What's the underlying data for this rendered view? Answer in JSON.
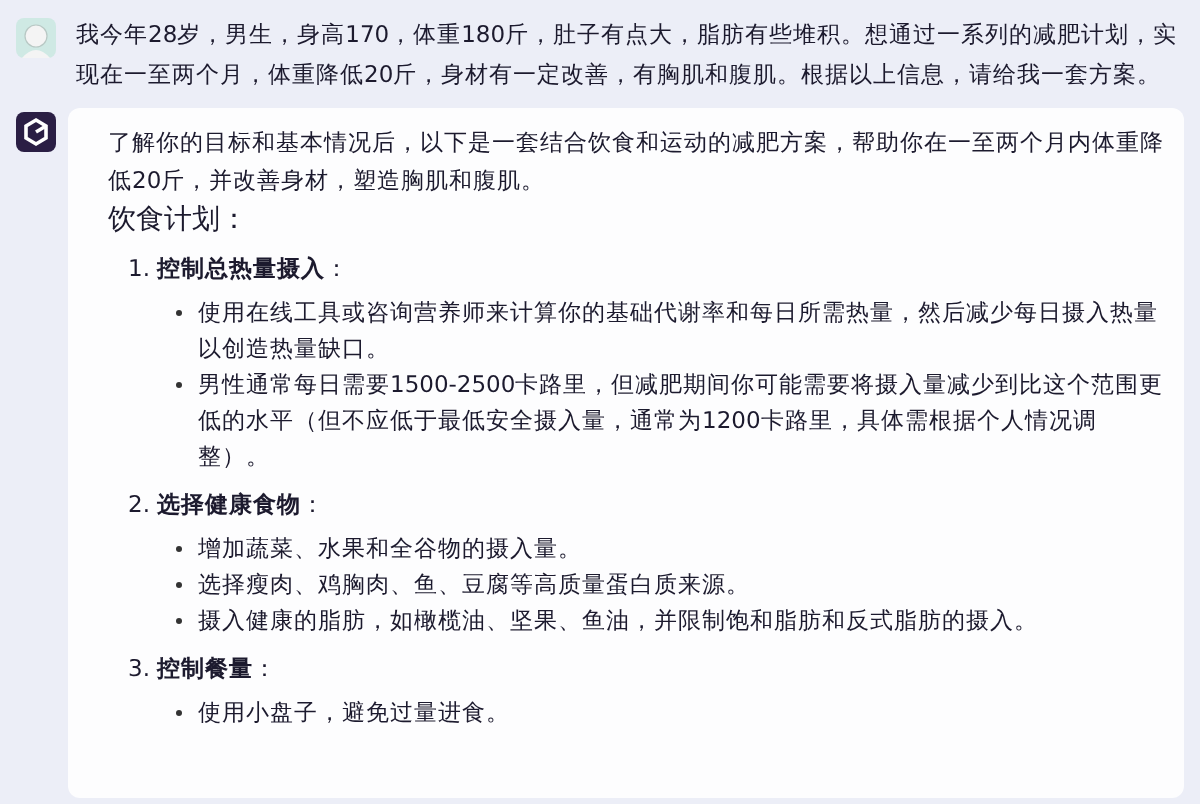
{
  "user_message": {
    "text": "我今年28岁，男生，身高170，体重180斤，肚子有点大，脂肪有些堆积。想通过一系列的减肥计划，实现在一至两个月，体重降低20斤，身材有一定改善，有胸肌和腹肌。根据以上信息，请给我一套方案。"
  },
  "reply": {
    "intro": "了解你的目标和基本情况后，以下是一套结合饮食和运动的减肥方案，帮助你在一至两个月内体重降低20斤，并改善身材，塑造胸肌和腹肌。",
    "heading": "饮食计划：",
    "sections": [
      {
        "title": "1. **控制总热量摄入**：",
        "bullets": [
          "使用在线工具或咨询营养师来计算你的基础代谢率和每日所需热量，然后减少每日摄入热量以创造热量缺口。",
          "男性通常每日需要1500-2500卡路里，但减肥期间你可能需要将摄入量减少到比这个范围更低的水平（但不应低于最低安全摄入量，通常为1200卡路里，具体需根据个人情况调整）。"
        ]
      },
      {
        "title": "2. **选择健康食物**：",
        "bullets": [
          "增加蔬菜、水果和全谷物的摄入量。",
          "选择瘦肉、鸡胸肉、鱼、豆腐等高质量蛋白质来源。",
          "摄入健康的脂肪，如橄榄油、坚果、鱼油，并限制饱和脂肪和反式脂肪的摄入。"
        ]
      },
      {
        "title": "3. **控制餐量**：",
        "bullets": [
          "使用小盘子，避免过量进食。"
        ]
      }
    ]
  }
}
